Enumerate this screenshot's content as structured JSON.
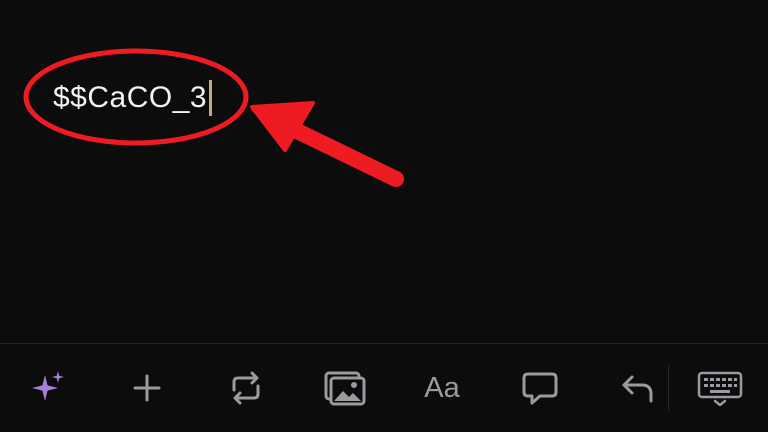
{
  "editor": {
    "text": "$$CaCO_3",
    "annotation_color": "#ee1c22"
  },
  "toolbar": {
    "format_label": "Aa",
    "icons": [
      "sparkles-icon",
      "plus-icon",
      "repeat-icon",
      "image-icon",
      "format-text-icon",
      "comment-icon",
      "undo-icon",
      "keyboard-icon"
    ],
    "accent_color": "#a77fd6"
  }
}
